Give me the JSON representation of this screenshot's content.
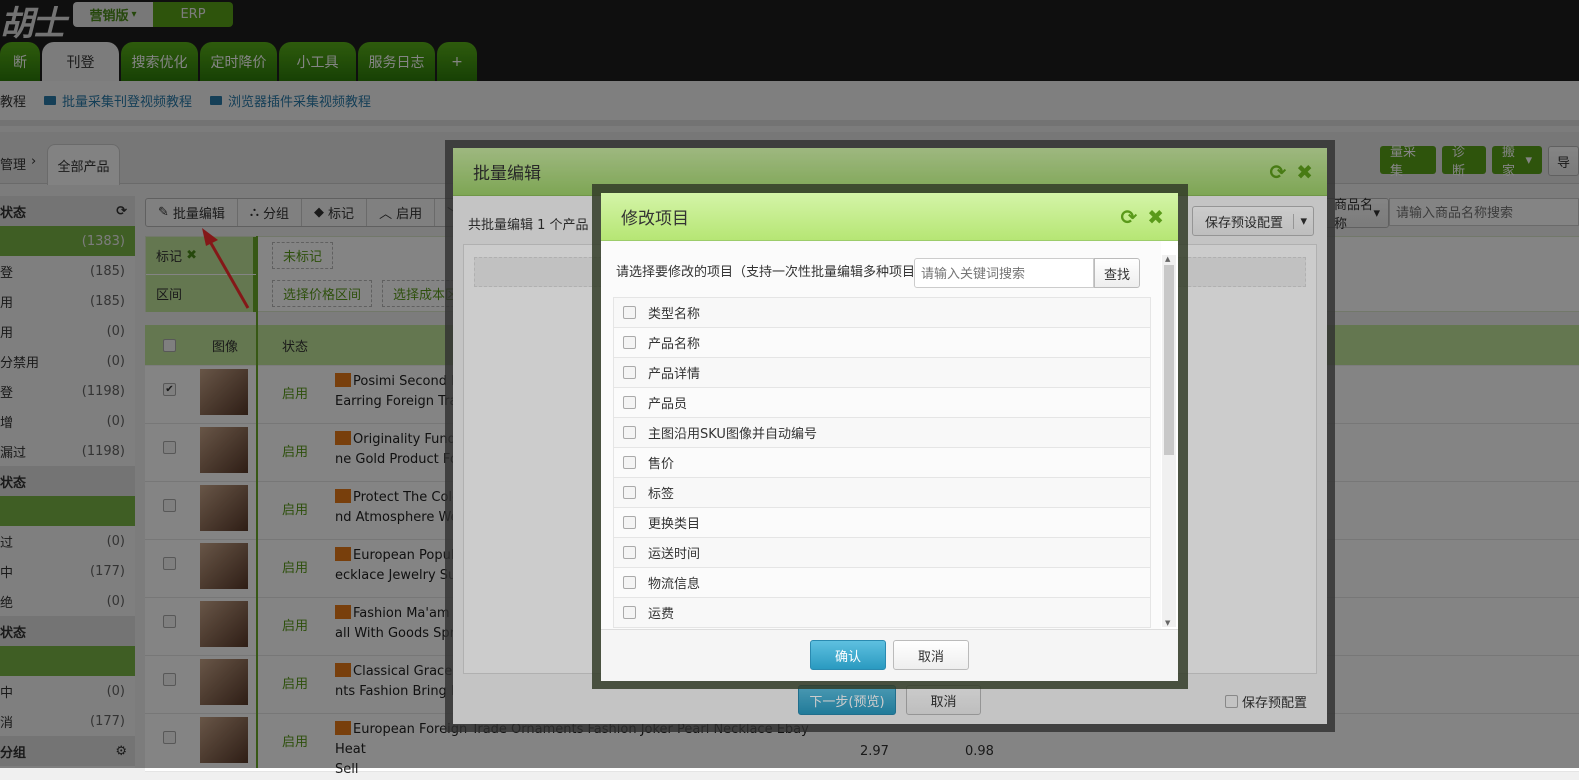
{
  "header": {
    "logo": "胡",
    "logo2": "士",
    "edition": "营销版",
    "edition_caret": "▾",
    "erp": "ERP"
  },
  "tabs": [
    {
      "label": "断"
    },
    {
      "label": "刊登",
      "active": true
    },
    {
      "label": "搜索优化"
    },
    {
      "label": "定时降价"
    },
    {
      "label": "小工具"
    },
    {
      "label": "服务日志"
    },
    {
      "label": "+"
    }
  ],
  "subnav": {
    "first": "教程",
    "links": [
      "批量采集刊登视频教程",
      "浏览器插件采集视频教程"
    ]
  },
  "breadcrumb": {
    "parent": "管理",
    "sep": "›",
    "current": "全部产品"
  },
  "sidebar": {
    "groups": [
      {
        "title": "状态",
        "icon": "refresh-icon",
        "items": [
          {
            "label": "",
            "count": "(1383)",
            "active": true
          },
          {
            "label": "登",
            "count": "(185)"
          },
          {
            "label": "用",
            "count": "(185)"
          },
          {
            "label": "用",
            "count": "(0)"
          },
          {
            "label": "分禁用",
            "count": "(0)"
          },
          {
            "label": "登",
            "count": "(1198)"
          },
          {
            "label": "增",
            "count": "(0)"
          },
          {
            "label": "漏过",
            "count": "(1198)"
          }
        ]
      },
      {
        "title": "状态",
        "items": [
          {
            "label": "",
            "count": "",
            "active": true
          },
          {
            "label": "过",
            "count": "(0)"
          },
          {
            "label": "中",
            "count": "(177)"
          },
          {
            "label": "绝",
            "count": "(0)"
          }
        ]
      },
      {
        "title": "状态",
        "items": [
          {
            "label": "",
            "count": "",
            "active": true
          },
          {
            "label": "中",
            "count": "(0)"
          },
          {
            "label": "消",
            "count": "(177)"
          }
        ]
      },
      {
        "title": "分组",
        "icon": "gear-icon",
        "items": []
      }
    ]
  },
  "toolbar": {
    "batch_edit": "批量编辑",
    "group": "分组",
    "mark": "标记",
    "enable": "启用"
  },
  "right_buttons": {
    "collect": "量采集",
    "diagnose": "诊断",
    "move": "搬家",
    "export": "导"
  },
  "filter": {
    "mark_label": "标记",
    "mark_remove": "✖",
    "unmarked": "未标记",
    "range_label": "区间",
    "price_range": "选择价格区间",
    "cost_range": "选择成本区"
  },
  "search": {
    "field": "商品名称",
    "placeholder": "请输入商品名称搜索"
  },
  "table": {
    "headers": [
      "图像",
      "状态"
    ],
    "rows": [
      {
        "checked": true,
        "status": "启用",
        "l1": "Posimi Second E",
        "l2": "Earring Foreign Tra"
      },
      {
        "checked": false,
        "status": "启用",
        "l1": "Originality Fund",
        "l2": "ne Gold Product Fo"
      },
      {
        "checked": false,
        "status": "启用",
        "l1": "Protect The Colo",
        "l2": "nd Atmosphere We"
      },
      {
        "checked": false,
        "status": "启用",
        "l1": "European Popula",
        "l2": "ecklace Jewelry Sui"
      },
      {
        "checked": false,
        "status": "启用",
        "l1": "Fashion Ma'am I",
        "l2": "all With Goods Spr"
      },
      {
        "checked": false,
        "status": "启用",
        "l1": "Classical Grace D",
        "l2": "nts Fashion Bring F"
      },
      {
        "checked": false,
        "status": "启用",
        "l1": "European Foreign Trade Ornaments Fashion Joker Pearl Necklace Ebay Heat",
        "l2": "Sell",
        "p1": "2.97",
        "p2": "0.98"
      }
    ]
  },
  "batch_modal": {
    "title": "批量编辑",
    "summary": "共批量编辑 1 个产品",
    "save_preset": "保存预设配置",
    "next": "下一步(预览)",
    "cancel": "取消",
    "save_preset_check": "保存预配置"
  },
  "item_modal": {
    "title": "修改项目",
    "prompt": "请选择要修改的项目（支持一次性批量编辑多种项目",
    "search_placeholder": "请输入关键词搜索",
    "search_button": "查找",
    "items": [
      "类型名称",
      "产品名称",
      "产品详情",
      "产品员",
      "主图沿用SKU图像并自动编号",
      "售价",
      "标签",
      "更换类目",
      "运送时间",
      "物流信息",
      "运费"
    ],
    "confirm": "确认",
    "cancel": "取消"
  },
  "colors": {
    "accent": "#5aa21a",
    "header_bg": "#1e1e1e",
    "confirm": "#2a9ac0",
    "annotation_arrow": "#ff3030"
  }
}
